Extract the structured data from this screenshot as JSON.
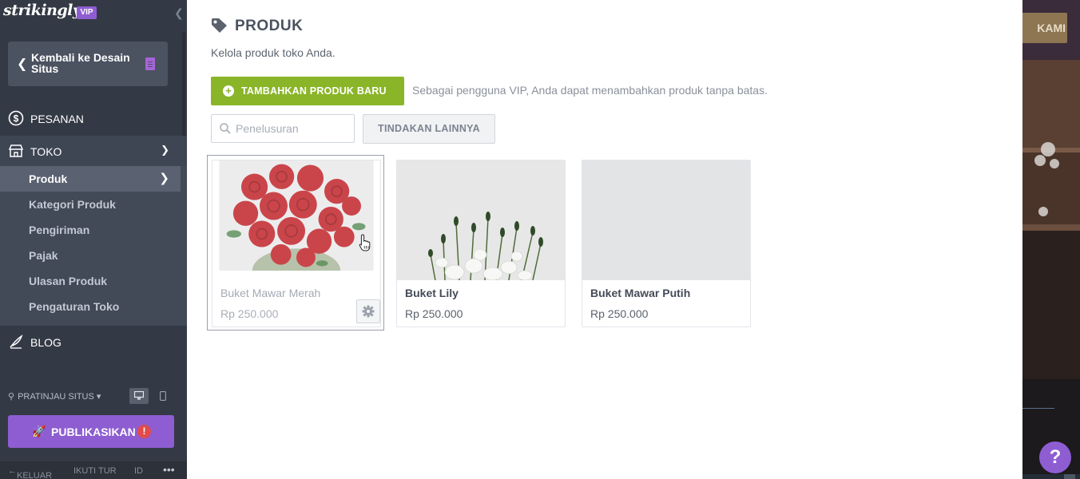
{
  "sidebar": {
    "brand": "strikingly",
    "vip_badge": "VIP",
    "back_button": "Kembali ke Desain Situs",
    "nav": {
      "orders": "PESANAN",
      "store": "TOKO",
      "blog": "BLOG"
    },
    "store_submenu": [
      {
        "label": "Produk",
        "active": true
      },
      {
        "label": "Kategori Produk",
        "active": false
      },
      {
        "label": "Pengiriman",
        "active": false
      },
      {
        "label": "Pajak",
        "active": false
      },
      {
        "label": "Ulasan Produk",
        "active": false
      },
      {
        "label": "Pengaturan Toko",
        "active": false
      }
    ],
    "preview_label": "PRATINJAU SITUS",
    "publish_button": "PUBLIKASIKAN",
    "publish_warning": "!",
    "footer": {
      "exit": "KELUAR",
      "tour": "IKUTI TUR",
      "lang": "ID",
      "more": "•••"
    }
  },
  "main": {
    "title": "PRODUK",
    "subtitle": "Kelola produk toko Anda.",
    "add_button": "TAMBAHKAN PRODUK BARU",
    "vip_note": "Sebagai pengguna VIP, Anda dapat menambahkan produk tanpa batas.",
    "search_placeholder": "Penelusuran",
    "more_actions": "TINDAKAN LAINNYA",
    "products": [
      {
        "name": "Buket Mawar Merah",
        "price": "Rp 250.000",
        "image": "red-roses"
      },
      {
        "name": "Buket Lily",
        "price": "Rp 250.000",
        "image": "white-lily"
      },
      {
        "name": "Buket Mawar Putih",
        "price": "Rp 250.000",
        "image": "blank-grey"
      }
    ]
  },
  "preview": {
    "nav_button": "KAMI",
    "help": "?"
  },
  "colors": {
    "sidebar_bg": "#343a45",
    "accent_purple": "#8e5dd1",
    "add_green": "#8ab528",
    "warning_red": "#e24b4b"
  }
}
